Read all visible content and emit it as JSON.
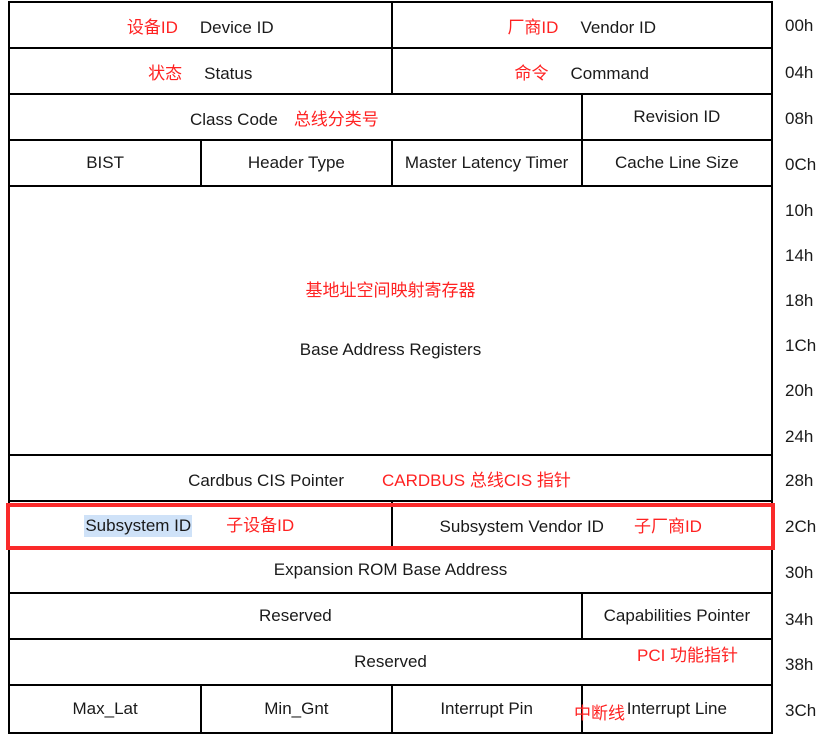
{
  "diagram": {
    "title": "PCI Configuration Space Header (Type 0)",
    "accent_red": "#ff2222",
    "highlight_border": "#fa2a2a",
    "selection_color": "#cfe2f8"
  },
  "rows": [
    {
      "offset": "00h",
      "cells": [
        {
          "zh": "设备ID",
          "en": "Device ID"
        },
        {
          "zh": "厂商ID",
          "en": "Vendor ID"
        }
      ]
    },
    {
      "offset": "04h",
      "cells": [
        {
          "zh": "状态",
          "en": "Status"
        },
        {
          "zh": "命令",
          "en": "Command"
        }
      ]
    },
    {
      "offset": "08h",
      "cells": [
        {
          "zh": "总线分类号",
          "en": "Class Code"
        },
        {
          "zh": "",
          "en": "Revision ID"
        }
      ]
    },
    {
      "offset": "0Ch",
      "cells": [
        {
          "zh": "",
          "en": "BIST"
        },
        {
          "zh": "",
          "en": "Header Type"
        },
        {
          "zh": "",
          "en": "Master Latency Timer"
        },
        {
          "zh": "",
          "en": "Cache Line Size"
        }
      ]
    }
  ],
  "bar": {
    "zh": "基地址空间映射寄存器",
    "en": "Base Address Registers",
    "offsets": [
      "10h",
      "14h",
      "18h",
      "1Ch",
      "20h",
      "24h"
    ]
  },
  "lower_rows": [
    {
      "offset": "28h",
      "cells": [
        {
          "zh": "CARDBUS 总线CIS 指针",
          "en": "Cardbus CIS Pointer"
        }
      ]
    },
    {
      "offset": "2Ch",
      "highlighted": true,
      "cells": [
        {
          "zh": "子设备ID",
          "en": "Subsystem ID",
          "selected": true
        },
        {
          "zh": "子厂商ID",
          "en": "Subsystem Vendor ID"
        }
      ]
    },
    {
      "offset": "30h",
      "cells": [
        {
          "zh": "",
          "en": "Expansion ROM Base Address"
        }
      ]
    },
    {
      "offset": "34h",
      "cells": [
        {
          "zh": "",
          "en": "Reserved"
        },
        {
          "zh": "",
          "en": "Capabilities Pointer"
        }
      ]
    },
    {
      "offset": "38h",
      "cells": [
        {
          "zh": "PCI 功能指针",
          "en": "Reserved"
        }
      ]
    },
    {
      "offset": "3Ch",
      "cells": [
        {
          "zh": "",
          "en": "Max_Lat"
        },
        {
          "zh": "",
          "en": "Min_Gnt"
        },
        {
          "zh": "",
          "en": "Interrupt Pin"
        },
        {
          "zh": "中断线",
          "en": "Interrupt Line"
        }
      ]
    }
  ],
  "offsets": {
    "o00": "00h",
    "o04": "04h",
    "o08": "08h",
    "o0C": "0Ch",
    "o10": "10h",
    "o14": "14h",
    "o18": "18h",
    "o1C": "1Ch",
    "o20": "20h",
    "o24": "24h",
    "o28": "28h",
    "o2C": "2Ch",
    "o30": "30h",
    "o34": "34h",
    "o38": "38h",
    "o3C": "3Ch"
  },
  "labels": {
    "device_id_zh": "设备ID",
    "device_id_en": "Device ID",
    "vendor_id_zh": "厂商ID",
    "vendor_id_en": "Vendor ID",
    "status_zh": "状态",
    "status_en": "Status",
    "command_zh": "命令",
    "command_en": "Command",
    "class_code_en": "Class Code",
    "class_code_zh": "总线分类号",
    "revision_id_en": "Revision ID",
    "bist_en": "BIST",
    "header_type_en": "Header Type",
    "master_latency_en": "Master Latency Timer",
    "cache_line_en": "Cache Line Size",
    "bar_zh": "基地址空间映射寄存器",
    "bar_en": "Base Address Registers",
    "cardbus_en": "Cardbus CIS Pointer",
    "cardbus_zh": "CARDBUS 总线CIS 指针",
    "subsystem_id_en": "Subsystem ID",
    "subsystem_id_zh": "子设备ID",
    "subsystem_vendor_en": "Subsystem Vendor ID",
    "subsystem_vendor_zh": "子厂商ID",
    "expansion_rom_en": "Expansion ROM Base Address",
    "reserved_34_en": "Reserved",
    "capabilities_en": "Capabilities Pointer",
    "reserved_38_en": "Reserved",
    "pci_cap_zh": "PCI 功能指针",
    "max_lat_en": "Max_Lat",
    "min_gnt_en": "Min_Gnt",
    "interrupt_pin_en": "Interrupt Pin",
    "interrupt_line_zh": "中断线",
    "interrupt_line_en": "Interrupt Line"
  }
}
